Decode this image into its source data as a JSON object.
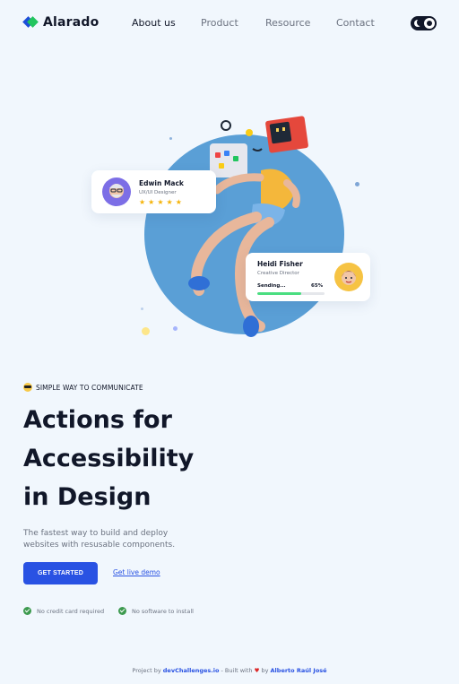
{
  "nav": {
    "brand": "Alarado",
    "links": [
      "About us",
      "Product",
      "Resource",
      "Contact"
    ],
    "active_index": 0,
    "theme_toggle_icons": [
      "moon-icon",
      "sun-icon"
    ]
  },
  "cards": {
    "edwin": {
      "name": "Edwin Mack",
      "role": "UX/UI Designer",
      "stars": "★★★★★",
      "rating": 5
    },
    "heidi": {
      "name": "Heidi Fisher",
      "role": "Creative Director",
      "progress_label": "Sending...",
      "progress_text": "65%",
      "progress": 0.65
    }
  },
  "hero": {
    "eyebrow": "SIMPLE WAY TO COMMUNICATE",
    "title_lines": [
      "Actions for",
      "Accessibility",
      "in Design"
    ],
    "subtitle": "The fastest way to build and deploy websites with resusable components.",
    "cta_primary": "GET STARTED",
    "cta_secondary": "Get live demo",
    "checks": [
      "No credit card required",
      "No software to install"
    ]
  },
  "footer": {
    "prefix": "Project by ",
    "site": "devChallenges.io",
    "built": " - Built with ",
    "by": " by ",
    "author": "Alberto Raúl José"
  },
  "colors": {
    "background": "#f1f7fd",
    "accent": "#2952e3",
    "circle": "#5a9fd6",
    "success": "#3d9a4f"
  }
}
